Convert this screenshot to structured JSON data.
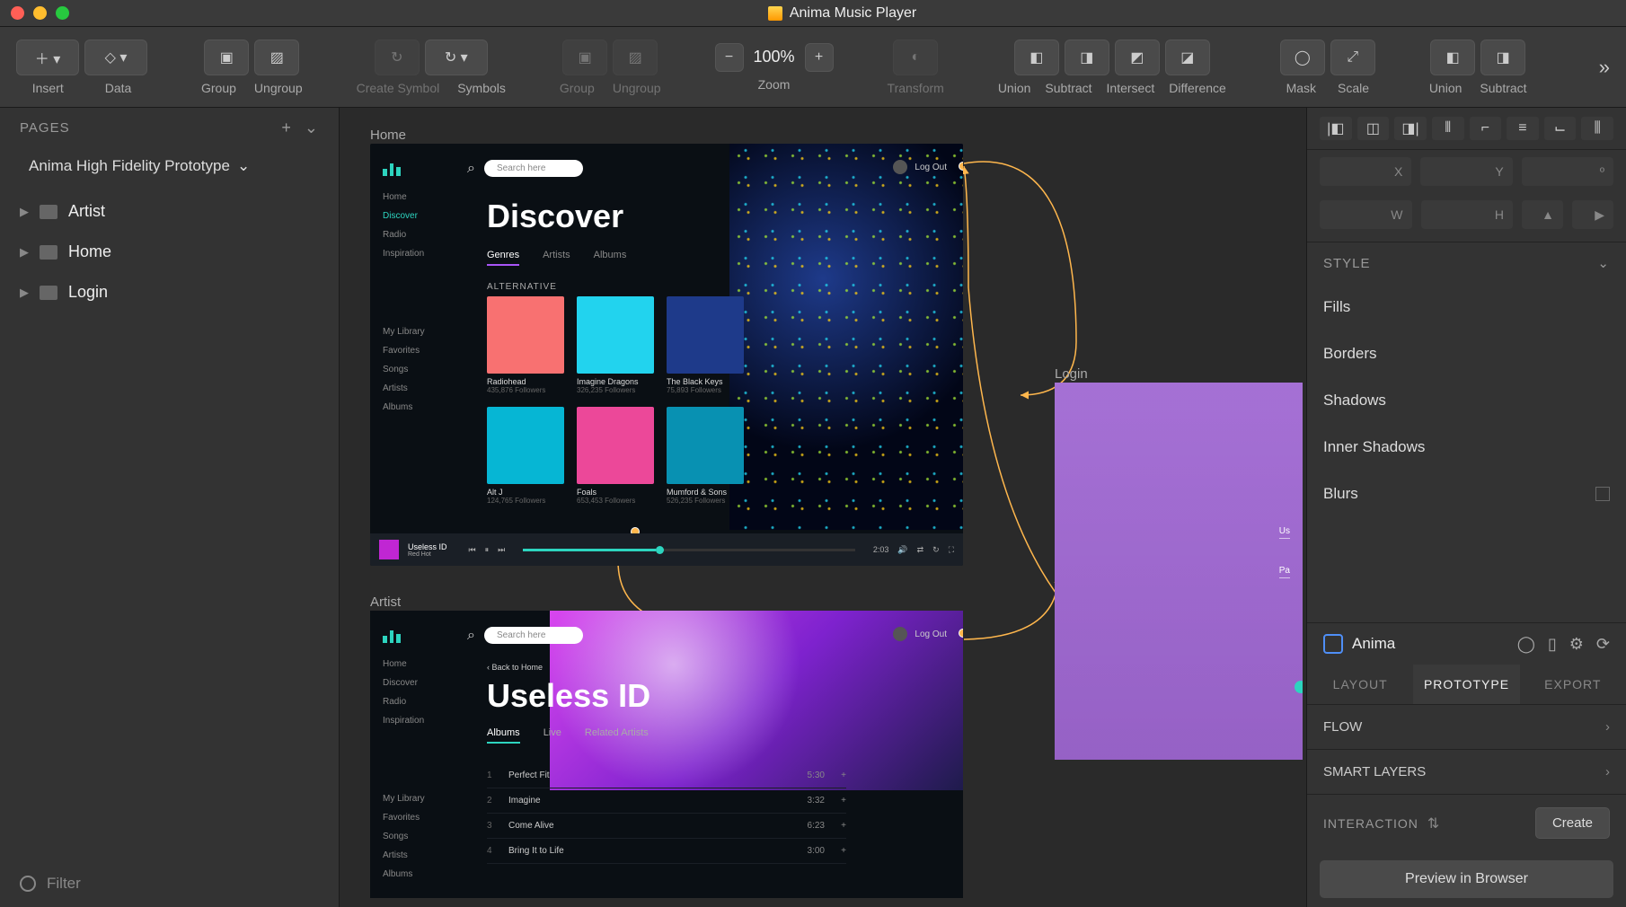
{
  "window": {
    "title": "Anima Music Player"
  },
  "toolbar": {
    "insert": "Insert",
    "data": "Data",
    "group": "Group",
    "ungroup": "Ungroup",
    "create_symbol": "Create Symbol",
    "symbols": "Symbols",
    "group2": "Group",
    "ungroup2": "Ungroup",
    "zoom": "Zoom",
    "zoom_value": "100%",
    "transform": "Transform",
    "union": "Union",
    "subtract": "Subtract",
    "intersect": "Intersect",
    "difference": "Difference",
    "mask": "Mask",
    "scale": "Scale",
    "union2": "Union",
    "subtract2": "Subtract"
  },
  "pages": {
    "header": "PAGES",
    "document": "Anima High Fidelity Prototype",
    "items": [
      "Artist",
      "Home",
      "Login"
    ]
  },
  "filter": "Filter",
  "canvas": {
    "home_label": "Home",
    "artist_label": "Artist",
    "login_label": "Login"
  },
  "home": {
    "search_placeholder": "Search here",
    "logout": "Log Out",
    "nav": [
      "Home",
      "Discover",
      "Radio",
      "Inspiration"
    ],
    "nav_active": "Discover",
    "nav2": [
      "My Library",
      "Favorites",
      "Songs",
      "Artists",
      "Albums"
    ],
    "title": "Discover",
    "tabs": [
      "Genres",
      "Artists",
      "Albums"
    ],
    "tabs_active": "Genres",
    "section": "ALTERNATIVE",
    "albums": [
      {
        "name": "Radiohead",
        "sub": "435,876 Followers",
        "bg": "#f87171"
      },
      {
        "name": "Imagine Dragons",
        "sub": "326,235 Followers",
        "bg": "#22d3ee"
      },
      {
        "name": "The Black Keys",
        "sub": "75,893 Followers",
        "bg": "#1e3a8a"
      },
      {
        "name": "Alt J",
        "sub": "124,765 Followers",
        "bg": "#06b6d4"
      },
      {
        "name": "Foals",
        "sub": "653,453 Followers",
        "bg": "#ec4899"
      },
      {
        "name": "Mumford & Sons",
        "sub": "526,235 Followers",
        "bg": "#0891b2"
      }
    ],
    "player": {
      "track": "Useless ID",
      "artist": "Red Hot",
      "duration": "2:03"
    }
  },
  "artist": {
    "search_placeholder": "Search here",
    "logout": "Log Out",
    "nav": [
      "Home",
      "Discover",
      "Radio",
      "Inspiration"
    ],
    "nav2": [
      "My Library",
      "Favorites",
      "Songs",
      "Artists",
      "Albums"
    ],
    "nav2_active": "Artists",
    "breadcrumb": "‹  Back to Home",
    "title": "Useless ID",
    "tabs": [
      "Albums",
      "Live",
      "Related Artists"
    ],
    "tabs_active": "Albums",
    "tracks": [
      {
        "n": "1",
        "title": "Perfect Fit",
        "dur": "5:30"
      },
      {
        "n": "2",
        "title": "Imagine",
        "dur": "3:32"
      },
      {
        "n": "3",
        "title": "Come Alive",
        "dur": "6:23"
      },
      {
        "n": "4",
        "title": "Bring It to Life",
        "dur": "3:00"
      }
    ]
  },
  "login": {
    "links": [
      "Us",
      "Pa"
    ]
  },
  "inspector": {
    "dims": {
      "x": "X",
      "y": "Y",
      "w": "W",
      "h": "H",
      "deg": "º"
    },
    "style": "STYLE",
    "style_items": [
      "Fills",
      "Borders",
      "Shadows",
      "Inner Shadows",
      "Blurs"
    ],
    "anima": "Anima",
    "tabs": [
      "LAYOUT",
      "PROTOTYPE",
      "EXPORT"
    ],
    "tabs_active": "PROTOTYPE",
    "flow": "FLOW",
    "smart_layers": "SMART LAYERS",
    "interaction": "INTERACTION",
    "create": "Create",
    "preview": "Preview in Browser"
  }
}
